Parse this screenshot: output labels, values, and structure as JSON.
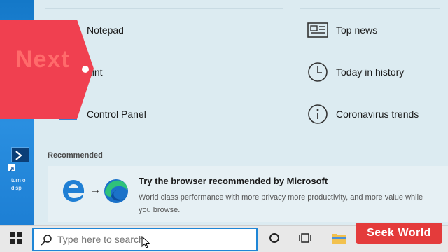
{
  "desktop": {
    "shortcut_label": "turn o\ndispl"
  },
  "apps": [
    {
      "label": "Notepad",
      "icon": "notepad-icon"
    },
    {
      "label": "Paint",
      "icon": "paint-icon"
    },
    {
      "label": "Control Panel",
      "icon": "control-panel-icon"
    }
  ],
  "apps_visible": {
    "paint_label": "aint"
  },
  "news": [
    {
      "label": "Top news",
      "icon": "newspaper-icon"
    },
    {
      "label": "Today in history",
      "icon": "clock-icon"
    },
    {
      "label": "Coronavirus trends",
      "icon": "info-icon"
    }
  ],
  "recommended": {
    "heading": "Recommended",
    "title": "Try the browser recommended by Microsoft",
    "description": "World class performance with more privacy more productivity, and more value while you browse.",
    "arrow": "→"
  },
  "overlay": {
    "next_text": "Next",
    "tag_color": "#f04050"
  },
  "taskbar": {
    "search_placeholder": "Type here to search"
  },
  "brand": {
    "text": "Seek World",
    "color": "#e43b3b"
  },
  "colors": {
    "accent": "#1f86d6",
    "panel": "#dcebf1"
  }
}
